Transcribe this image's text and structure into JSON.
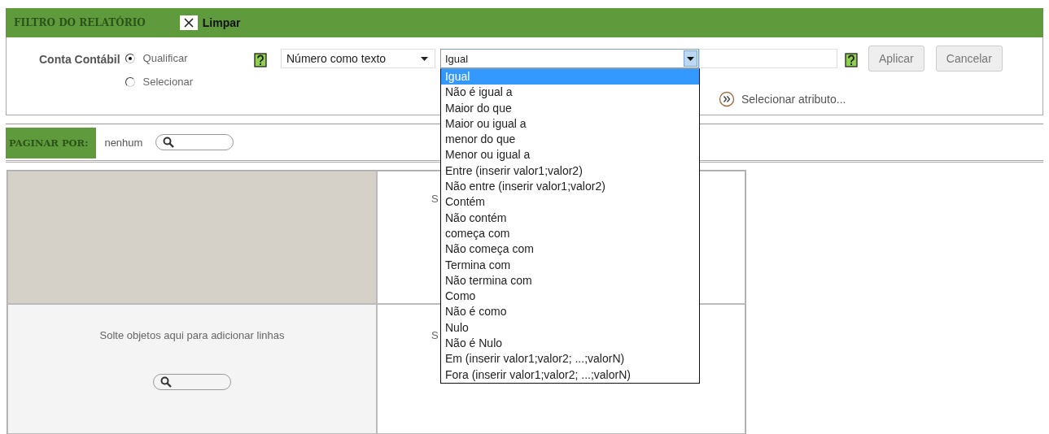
{
  "header": {
    "title": "FILTRO DO RELATÓRIO",
    "clear_button": "Limpar"
  },
  "filter": {
    "label": "Conta Contábil",
    "modes": [
      {
        "label": "Qualificar",
        "selected": true
      },
      {
        "label": "Selecionar",
        "selected": false
      }
    ],
    "type_select": "Número como texto",
    "operator_select": {
      "value": "Igual",
      "expanded": true
    },
    "apply_button": "Aplicar",
    "cancel_button": "Cancelar",
    "attribute_link": "Selecionar atributo..."
  },
  "operator_options": [
    {
      "label": "Igual",
      "selected": true
    },
    {
      "label": "Não é igual a",
      "selected": false
    },
    {
      "label": "Maior do que",
      "selected": false
    },
    {
      "label": "Maior ou igual a",
      "selected": false
    },
    {
      "label": "menor do que",
      "selected": false
    },
    {
      "label": "Menor ou igual a",
      "selected": false
    },
    {
      "label": "Entre (inserir valor1;valor2)",
      "selected": false
    },
    {
      "label": "Não entre (inserir valor1;valor2)",
      "selected": false
    },
    {
      "label": "Contém",
      "selected": false
    },
    {
      "label": "Não contém",
      "selected": false
    },
    {
      "label": "começa com",
      "selected": false
    },
    {
      "label": "Não começa com",
      "selected": false
    },
    {
      "label": "Termina com",
      "selected": false
    },
    {
      "label": "Não termina com",
      "selected": false
    },
    {
      "label": "Como",
      "selected": false
    },
    {
      "label": "Não é como",
      "selected": false
    },
    {
      "label": "Nulo",
      "selected": false
    },
    {
      "label": "Não é Nulo",
      "selected": false
    },
    {
      "label": "Em (inserir valor1;valor2; ...;valorN)",
      "selected": false
    },
    {
      "label": "Fora (inserir valor1;valor2; ...;valorN)",
      "selected": false
    }
  ],
  "page_by": {
    "label": "PAGINAR POR:",
    "value": "nenhum"
  },
  "grid": {
    "column_drop_zone": "S",
    "row_drop_zone": "Solte objetos aqui para adicionar linhas",
    "data_drop_zone": "S"
  }
}
